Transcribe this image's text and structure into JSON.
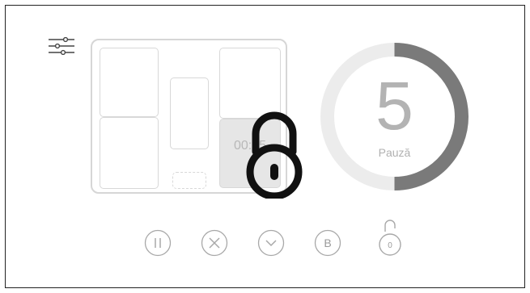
{
  "cooking": {
    "timer": "00:35",
    "program_value": "5",
    "status": "Pauză"
  },
  "controls": {
    "stop_label": "B",
    "child_lock_count": "0"
  },
  "colors": {
    "ring_track": "#ececec",
    "ring_progress": "#7a7a7a",
    "lock_overlay": "#111111"
  },
  "icons": [
    "sliders-icon",
    "pause-icon",
    "cancel-icon",
    "chevron-down-icon",
    "lock-icon"
  ]
}
